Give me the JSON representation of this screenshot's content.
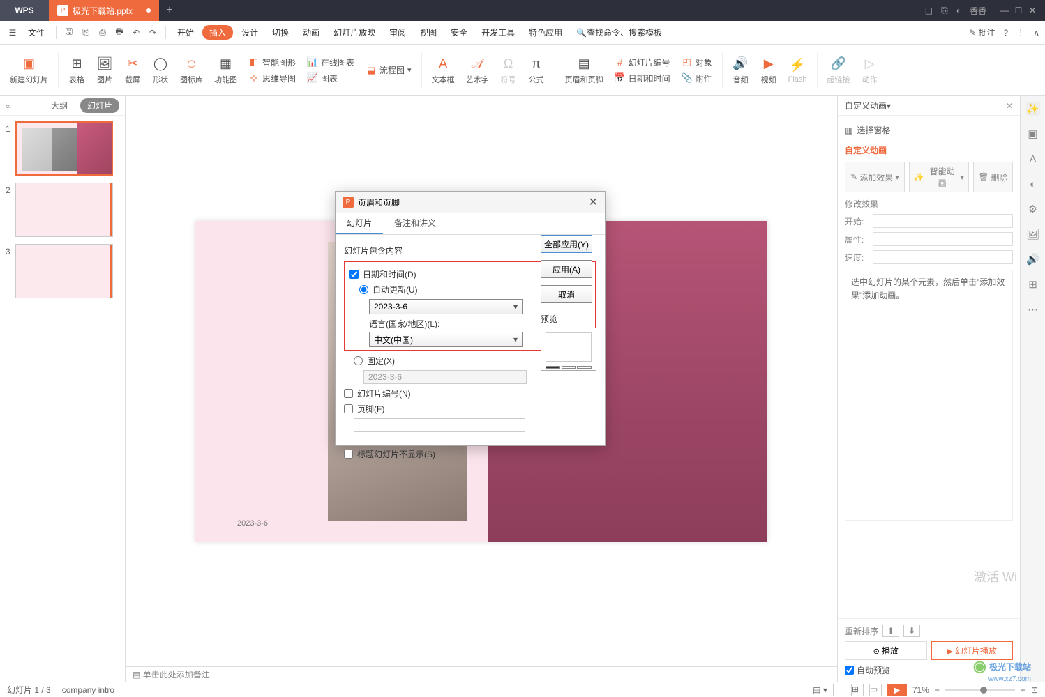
{
  "titlebar": {
    "logo": "WPS",
    "tab_name": "极光下载站.pptx",
    "user": "香香"
  },
  "menubar": {
    "file": "文件",
    "items": [
      "开始",
      "插入",
      "设计",
      "切换",
      "动画",
      "幻灯片放映",
      "审阅",
      "视图",
      "安全",
      "开发工具",
      "特色应用"
    ],
    "active_index": 1,
    "search": "查找命令、搜索模板",
    "annotate": "批注"
  },
  "ribbon": {
    "new_slide": "新建幻灯片",
    "table": "表格",
    "picture": "图片",
    "screenshot": "截屏",
    "shape": "形状",
    "icon_lib": "图标库",
    "func_chart": "功能图",
    "smart_graphic": "智能图形",
    "online_chart": "在线图表",
    "flowchart": "流程图",
    "mindmap": "思维导图",
    "chart": "图表",
    "textbox": "文本框",
    "wordart": "艺术字",
    "symbol": "符号",
    "formula": "公式",
    "header_footer": "页眉和页脚",
    "slide_number": "幻灯片编号",
    "date_time": "日期和时间",
    "object": "对象",
    "attachment": "附件",
    "audio": "音频",
    "video": "视频",
    "flash": "Flash",
    "hyperlink": "超链接",
    "action": "动作"
  },
  "panel": {
    "outline": "大纲",
    "slides": "幻灯片",
    "collapse": "«"
  },
  "slide": {
    "date": "2023-3-6"
  },
  "notes": {
    "placeholder": "单击此处添加备注"
  },
  "right_panel": {
    "title": "自定义动画",
    "select_pane": "选择窗格",
    "section": "自定义动画",
    "add_effect": "添加效果",
    "smart_anim": "智能动画",
    "delete": "删除",
    "modify": "修改效果",
    "start": "开始:",
    "property": "属性:",
    "speed": "速度:",
    "hint": "选中幻灯片的某个元素，然后单击\"添加效果\"添加动画。",
    "reorder": "重新排序",
    "play": "播放",
    "slideshow": "幻灯片播放",
    "auto_preview": "自动预览"
  },
  "dialog": {
    "title": "页眉和页脚",
    "tab_slide": "幻灯片",
    "tab_notes": "备注和讲义",
    "section": "幻灯片包含内容",
    "date_time": "日期和时间(D)",
    "auto_update": "自动更新(U)",
    "date_value": "2023-3-6",
    "lang_label": "语言(国家/地区)(L):",
    "lang_value": "中文(中国)",
    "fixed": "固定(X)",
    "fixed_value": "2023-3-6",
    "slide_number": "幻灯片编号(N)",
    "footer": "页脚(F)",
    "no_show_title": "标题幻灯片不显示(S)",
    "apply_all": "全部应用(Y)",
    "apply": "应用(A)",
    "cancel": "取消",
    "preview": "预览"
  },
  "status": {
    "slide_info": "幻灯片 1 / 3",
    "template": "company intro",
    "zoom": "71%"
  },
  "watermark": {
    "name": "极光下载站",
    "url": "www.xz7.com"
  },
  "activate": "激活 Wi"
}
